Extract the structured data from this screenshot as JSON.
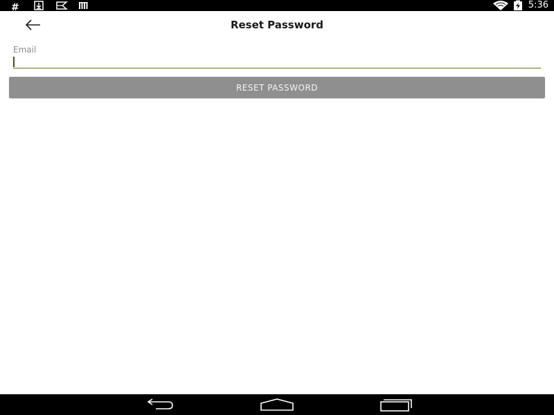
{
  "status_bar": {
    "icons": [
      "hash-icon",
      "download-icon",
      "notification-flag-icon",
      "barcode-icon",
      "wifi-icon",
      "battery-charging-icon"
    ],
    "hash_glyph": "#",
    "time": "5:36"
  },
  "app_bar": {
    "title": "Reset Password",
    "back_icon": "arrow-left-icon"
  },
  "form": {
    "email_label": "Email",
    "email_value": "",
    "button_label": "RESET PASSWORD",
    "button_color": "#8f8f8f",
    "underline_color": "#6b6b1e"
  },
  "nav_bar": {
    "icons": [
      "back-nav-icon",
      "home-nav-icon",
      "recents-nav-icon"
    ]
  }
}
